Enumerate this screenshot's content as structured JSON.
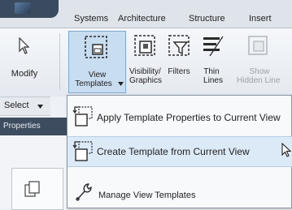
{
  "tabs": [
    "Systems",
    "Architecture",
    "Structure",
    "Insert"
  ],
  "ribbon": {
    "modify_label": "Modify",
    "select_label": "Select",
    "view_templates_label_1": "View",
    "view_templates_label_2": "Templates",
    "visibility_label_1": "Visibility/",
    "visibility_label_2": "Graphics",
    "filters_label": "Filters",
    "thin_lines_label_1": "Thin",
    "thin_lines_label_2": "Lines",
    "show_hidden_label_1": "Show",
    "show_hidden_label_2": "Hidden Line"
  },
  "properties_label": "Properties",
  "menu": {
    "items": [
      {
        "label": "Apply Template Properties to Current View"
      },
      {
        "label": "Create Template from Current View"
      },
      {
        "label": "Manage View Templates"
      }
    ]
  },
  "colors": {
    "accent_highlight": "#c9ddf0",
    "menu_hover": "#dce9f6",
    "panel_header": "#3e4c60"
  }
}
